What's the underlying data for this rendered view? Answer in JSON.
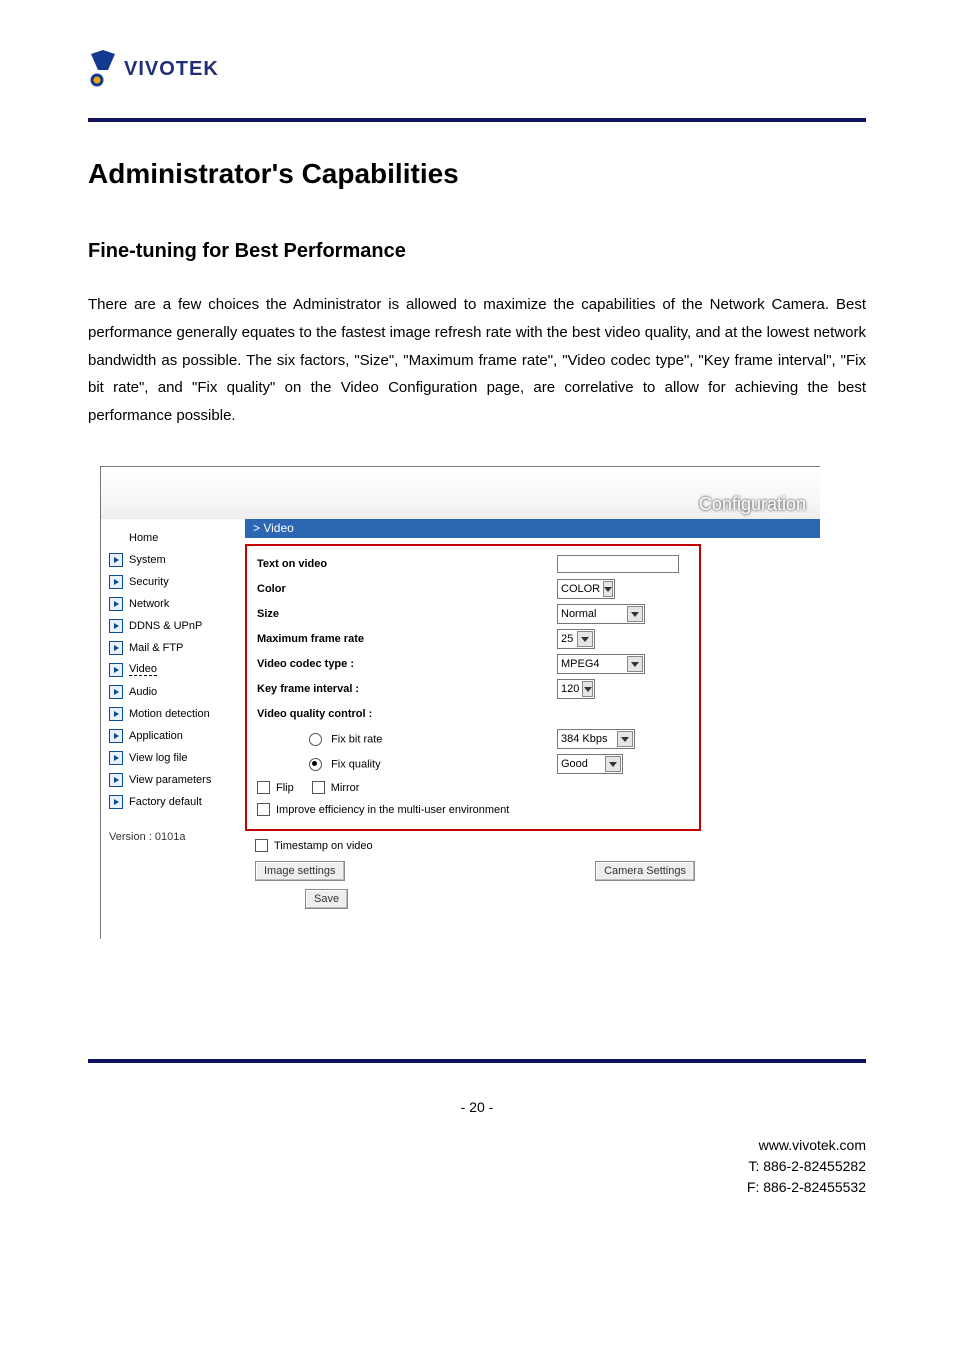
{
  "logo_text": "VIVOTEK",
  "doc": {
    "title": "Administrator's Capabilities",
    "subtitle": "Fine-tuning for Best Performance",
    "paragraph": "There are a few choices the Administrator is allowed to maximize the capabilities of the Network Camera. Best performance generally equates to the fastest image refresh rate with the best video quality, and at the lowest network bandwidth as possible. The six factors, \"Size\", \"Maximum frame rate\", \"Video codec type\", \"Key frame interval\", \"Fix bit rate\", and \"Fix quality\" on the Video Configuration page, are correlative to allow for achieving the best performance possible."
  },
  "config": {
    "header": "Configuration",
    "breadcrumb": "> Video",
    "sidebar": {
      "home": "Home",
      "items": [
        "System",
        "Security",
        "Network",
        "DDNS & UPnP",
        "Mail & FTP",
        "Video",
        "Audio",
        "Motion detection",
        "Application",
        "View log file",
        "View parameters",
        "Factory default"
      ],
      "version": "Version : 0101a"
    },
    "form": {
      "text_on_video": {
        "label": "Text on video",
        "value": ""
      },
      "color": {
        "label": "Color",
        "value": "COLOR"
      },
      "size": {
        "label": "Size",
        "value": "Normal"
      },
      "max_frame_rate": {
        "label": "Maximum frame rate",
        "value": "25"
      },
      "codec": {
        "label": "Video codec type :",
        "value": "MPEG4"
      },
      "key_frame": {
        "label": "Key frame interval :",
        "value": "120"
      },
      "quality_control_label": "Video quality control :",
      "fix_bit_rate": {
        "label": "Fix bit rate",
        "value": "384 Kbps",
        "selected": false
      },
      "fix_quality": {
        "label": "Fix quality",
        "value": "Good",
        "selected": true
      },
      "flip": "Flip",
      "mirror": "Mirror",
      "improve_eff": "Improve efficiency in the multi-user environment",
      "timestamp": "Timestamp on video",
      "btn_image_settings": "Image settings",
      "btn_camera_settings": "Camera  Settings",
      "btn_save": "Save"
    }
  },
  "footer": {
    "page": "- 20 -",
    "url": "www.vivotek.com",
    "tel": "T: 886-2-82455282",
    "fax": "F: 886-2-82455532"
  }
}
